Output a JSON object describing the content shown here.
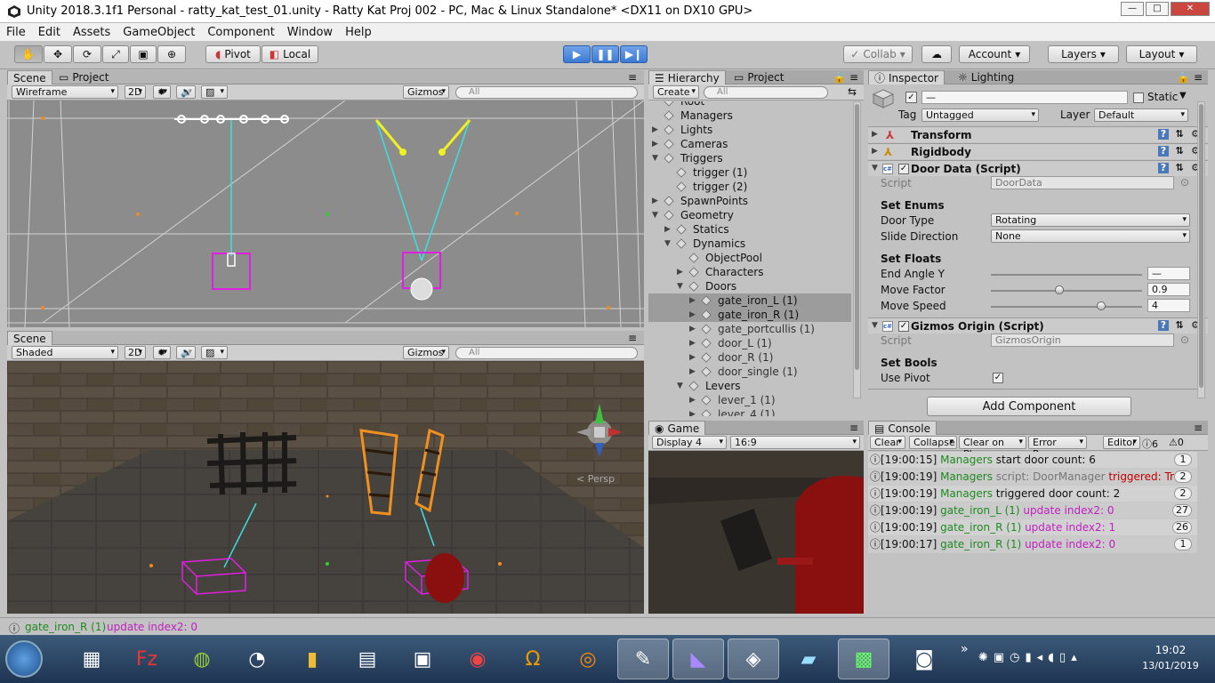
{
  "window": {
    "title": "Unity 2018.3.1f1 Personal - ratty_kat_test_01.unity - Ratty Kat Proj 002 - PC, Mac & Linux Standalone* <DX11 on DX10 GPU>",
    "min": "—",
    "max": "□",
    "close": "✕"
  },
  "menu": [
    "File",
    "Edit",
    "Assets",
    "GameObject",
    "Component",
    "Window",
    "Help"
  ],
  "toolbar": {
    "pivot": "Pivot",
    "local": "Local",
    "collab": "Collab",
    "account": "Account",
    "layers": "Layers",
    "layout": "Layout"
  },
  "scene_top": {
    "tab1": "Scene",
    "tab2": "Project",
    "mode": "Wireframe",
    "btn2d": "2D",
    "gizmos": "Gizmos",
    "search": "All"
  },
  "scene_bottom": {
    "tab1": "Scene",
    "mode": "Shaded",
    "btn2d": "2D",
    "gizmos": "Gizmos",
    "search": "All",
    "persp": "< Persp"
  },
  "hierarchy": {
    "tab1": "Hierarchy",
    "tab2": "Project",
    "create": "Create",
    "search": "All",
    "rows": [
      {
        "t": "Root",
        "d": 1,
        "a": ""
      },
      {
        "t": "Managers",
        "d": 1,
        "a": ""
      },
      {
        "t": "Lights",
        "d": 1,
        "a": "▶"
      },
      {
        "t": "Cameras",
        "d": 1,
        "a": "▶"
      },
      {
        "t": "Triggers",
        "d": 1,
        "a": "▼"
      },
      {
        "t": "trigger (1)",
        "d": 2,
        "a": ""
      },
      {
        "t": "trigger (2)",
        "d": 2,
        "a": ""
      },
      {
        "t": "SpawnPoints",
        "d": 1,
        "a": "▶"
      },
      {
        "t": "Geometry",
        "d": 1,
        "a": "▼"
      },
      {
        "t": "Statics",
        "d": 2,
        "a": "▶"
      },
      {
        "t": "Dynamics",
        "d": 2,
        "a": "▼"
      },
      {
        "t": "ObjectPool",
        "d": 3,
        "a": ""
      },
      {
        "t": "Characters",
        "d": 3,
        "a": "▶"
      },
      {
        "t": "Doors",
        "d": 3,
        "a": "▼"
      },
      {
        "t": "gate_iron_L (1)",
        "d": 4,
        "a": "▶",
        "hl": true
      },
      {
        "t": "gate_iron_R (1)",
        "d": 4,
        "a": "▶",
        "hl": true
      },
      {
        "t": "gate_portcullis (1)",
        "d": 4,
        "a": "▶"
      },
      {
        "t": "door_L (1)",
        "d": 4,
        "a": "▶"
      },
      {
        "t": "door_R (1)",
        "d": 4,
        "a": "▶"
      },
      {
        "t": "door_single (1)",
        "d": 4,
        "a": "▶"
      },
      {
        "t": "Levers",
        "d": 3,
        "a": "▼"
      },
      {
        "t": "lever_1 (1)",
        "d": 4,
        "a": "▶"
      },
      {
        "t": "lever_4 (1)",
        "d": 4,
        "a": "▶"
      }
    ]
  },
  "game": {
    "tab": "Game",
    "display": "Display 4",
    "aspect": "16:9"
  },
  "inspector": {
    "tab1": "Inspector",
    "tab2": "Lighting",
    "name": "—",
    "static": "Static",
    "tag_label": "Tag",
    "tag": "Untagged",
    "layer_label": "Layer",
    "layer": "Default",
    "transform": "Transform",
    "rigidbody": "Rigidbody",
    "door_data": "Door Data (Script)",
    "script_label": "Script",
    "door_script": "DoorData",
    "set_enums": "Set Enums",
    "door_type_label": "Door Type",
    "door_type": "Rotating",
    "slide_label": "Slide Direction",
    "slide": "None",
    "set_floats": "Set Floats",
    "end_angle_label": "End Angle Y",
    "end_angle": "—",
    "move_factor_label": "Move Factor",
    "move_factor": "0.9",
    "move_speed_label": "Move Speed",
    "move_speed": "4",
    "move_factor_level": 0.45,
    "move_speed_level": 0.73,
    "gizmos_origin": "Gizmos Origin (Script)",
    "gizmos_script": "GizmosOrigin",
    "set_bools": "Set Bools",
    "use_pivot_label": "Use Pivot",
    "add_component": "Add Component"
  },
  "console": {
    "tab": "Console",
    "clear": "Clear",
    "collapse": "Collapse",
    "clear_on_play": "Clear on Play",
    "error_pause": "Error Pause",
    "editor": "Editor",
    "count_info": "6",
    "count_warn": "0",
    "rows": [
      {
        "time": "[19:00:15]",
        "src": "Managers",
        "msg": " start door count: 6",
        "msgc": "n",
        "extra": "",
        "count": "1"
      },
      {
        "time": "[19:00:19]",
        "src": "Managers",
        "msg": " script: DoorManager",
        "msgc": "grey",
        "extra": " triggered: True",
        "count": "2"
      },
      {
        "time": "[19:00:19]",
        "src": "Managers",
        "msg": " triggered door count: 2",
        "msgc": "n",
        "extra": "",
        "count": "2"
      },
      {
        "time": "[19:00:19]",
        "src": "gate_iron_L (1)",
        "msg": " update index2: 0",
        "msgc": "m",
        "extra": "",
        "count": "27"
      },
      {
        "time": "[19:00:19]",
        "src": "gate_iron_R (1)",
        "msg": " update index2: 1",
        "msgc": "m",
        "extra": "",
        "count": "26"
      },
      {
        "time": "[19:00:17]",
        "src": "gate_iron_R (1)",
        "msg": " update index2: 0",
        "msgc": "m",
        "extra": "",
        "count": "1"
      }
    ]
  },
  "status": {
    "src": "gate_iron_R (1)",
    "msg": " update index2: 0"
  },
  "taskbar": {
    "time": "19:02",
    "date": "13/01/2019",
    "apps": [
      "windows-start-icon",
      "calculator-icon",
      "filezilla-icon",
      "android-icon",
      "speaker-icon",
      "folder-icon",
      "calendar-icon",
      "computer-icon",
      "chrome-icon",
      "headphones-icon",
      "blender-icon",
      "paint-icon",
      "visual-studio-icon",
      "unity-icon",
      "notepad-icon",
      "terminal-icon",
      "remote-desktop-icon"
    ]
  }
}
